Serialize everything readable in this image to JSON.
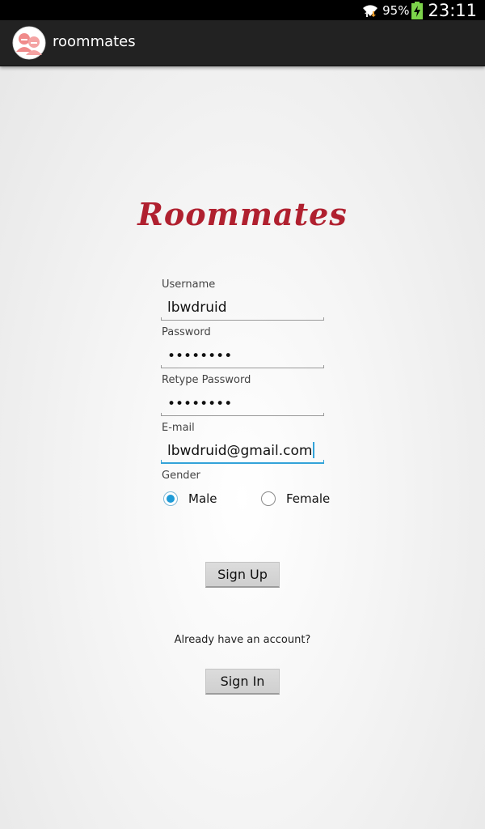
{
  "status_bar": {
    "battery_percent": "95%",
    "time": "23:11",
    "icons": [
      "wifi-icon",
      "battery-charging-icon"
    ]
  },
  "action_bar": {
    "title": "roommates",
    "icon": "roommates-app-icon"
  },
  "logo": {
    "text": "Roommates",
    "color": "#b0202f"
  },
  "form": {
    "username": {
      "label": "Username",
      "value": "lbwdruid"
    },
    "password": {
      "label": "Password",
      "value": "••••••••"
    },
    "retype_password": {
      "label": "Retype Password",
      "value": "••••••••"
    },
    "email": {
      "label": "E-mail",
      "value": "lbwdruid@gmail.com",
      "focused": true
    },
    "gender": {
      "label": "Gender",
      "options": [
        {
          "label": "Male",
          "checked": true
        },
        {
          "label": "Female",
          "checked": false
        }
      ]
    }
  },
  "buttons": {
    "sign_up": "Sign Up",
    "already_text": "Already have an account?",
    "sign_in": "Sign In"
  },
  "colors": {
    "accent": "#33a3d9",
    "radio_checked": "#1e9bd7",
    "action_bar": "#222222"
  }
}
